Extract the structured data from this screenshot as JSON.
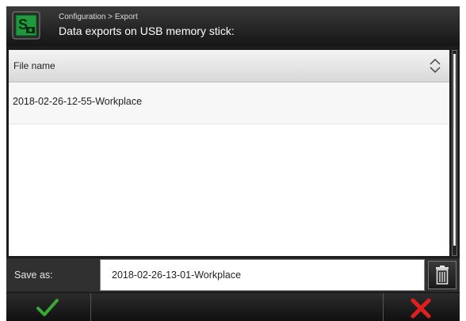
{
  "header": {
    "breadcrumb": "Configuration > Export",
    "title": "Data exports on USB memory stick:",
    "logo_icon": "s-logo-icon",
    "accent_color": "#1f9a3e"
  },
  "table": {
    "column_header": "File name",
    "sort_icon": "sort-up-down-icon",
    "rows": [
      {
        "file_name": "2018-02-26-12-55-Workplace"
      }
    ]
  },
  "save": {
    "label": "Save as:",
    "value": "2018-02-26-13-01-Workplace",
    "delete_icon": "trash-icon"
  },
  "footer": {
    "ok_icon": "checkmark-icon",
    "ok_color": "#39a935",
    "cancel_icon": "x-icon",
    "cancel_color": "#e02020"
  }
}
